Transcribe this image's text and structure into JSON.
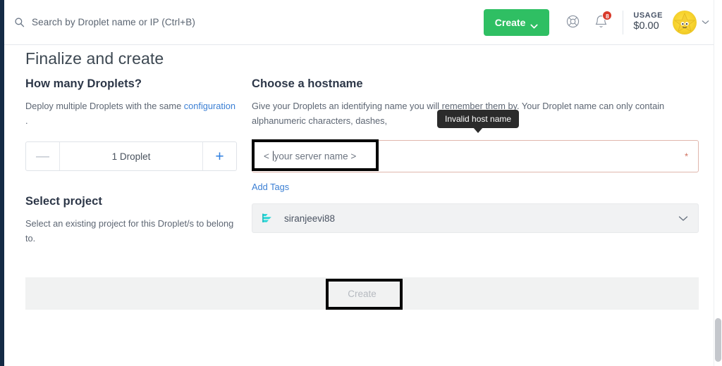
{
  "header": {
    "search": {
      "placeholder": "Search by Droplet name or IP (Ctrl+B)",
      "value": "",
      "icon": "search-icon"
    },
    "create_button": {
      "label": "Create",
      "icon": "chevron-down-icon",
      "color": "#2fbf63"
    },
    "help_icon": "lifebuoy-icon",
    "notifications": {
      "icon": "bell-icon",
      "badge_count": "8",
      "badge_color": "#d83a2b"
    },
    "usage": {
      "label": "USAGE",
      "value": "$0.00"
    },
    "avatar": {
      "name": "avatar",
      "caret_icon": "chevron-down-icon"
    }
  },
  "page": {
    "title": "Finalize and create",
    "left_column": {
      "droplets": {
        "heading": "How many Droplets?",
        "description_before_link": "Deploy multiple Droplets with the same ",
        "description_link": "configuration",
        "description_after_link": " .",
        "stepper": {
          "decrement_label": "—",
          "increment_label": "+",
          "value": "1  Droplet"
        }
      },
      "project": {
        "heading": "Select project",
        "description": "Select an existing project for this Droplet/s to belong to."
      }
    },
    "right_column": {
      "hostname": {
        "heading": "Choose a hostname",
        "description": "Give your Droplets an identifying name you will remember them by. Your Droplet name can only contain alphanumeric characters, dashes,",
        "input_placeholder_prefix": "< ",
        "input_placeholder_suffix": "your server name >",
        "input_value": "",
        "required_marker": "*",
        "error_border_color": "#e0b6ad",
        "tooltip": "Invalid host name"
      },
      "add_tags_label": "Add Tags",
      "project_select": {
        "value": "siranjeevi88",
        "icon": "project-folder-icon",
        "icon_color": "#26d0ce",
        "caret_icon": "chevron-down-icon"
      }
    },
    "footer": {
      "create_button_label": "Create",
      "create_button_disabled": true
    }
  }
}
